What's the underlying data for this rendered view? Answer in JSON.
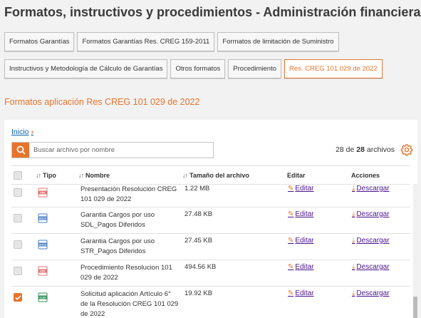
{
  "page": {
    "title": "Formatos, instructivos y procedimientos - Administración financiera"
  },
  "tabs_row1": [
    {
      "label": "Formatos Garantías"
    },
    {
      "label": "Formatos Garantías Res. CREG 159-2011"
    },
    {
      "label": "Formatos de limitación de Suministro"
    }
  ],
  "tabs_row2": [
    {
      "label": "Instructivos y Metodología de Cálculo de Garantías"
    },
    {
      "label": "Otros formatos"
    },
    {
      "label": "Procedimiento"
    },
    {
      "label": "Res. CREG 101 029 de 2022",
      "active": true
    }
  ],
  "section": {
    "title": "Formatos aplicación Res CREG 101 029 de 2022"
  },
  "breadcrumb": {
    "label": "Inicio"
  },
  "search": {
    "placeholder": "Buscar archivo por nombre"
  },
  "count": {
    "prefix": "28 de",
    "shown": "28",
    "suffix": "archivos"
  },
  "table": {
    "headers": {
      "type": "Tipo",
      "name": "Nombre",
      "size": "Tamaño del archivo",
      "edit": "Editar",
      "actions": "Acciones"
    },
    "rows": [
      {
        "type": "PDF",
        "name": "Presentación Resolución CREG 101 029 de 2022",
        "size": "1.22 MB",
        "edit": "Editar",
        "action": "Descargar",
        "checked": false
      },
      {
        "type": "DOCX",
        "name": "Garantia Cargos por uso SDL_Pagos Diferidos",
        "size": "27.48 KB",
        "edit": "Editar",
        "action": "Descargar",
        "checked": false
      },
      {
        "type": "DOCX",
        "name": "Garantia Cargos por uso STR_Pagos Diferidos",
        "size": "27.45 KB",
        "edit": "Editar",
        "action": "Descargar",
        "checked": false
      },
      {
        "type": "PDF",
        "name": "Procedimiento Resolucion 101 029 de 2022",
        "size": "494.56 KB",
        "edit": "Editar",
        "action": "Descargar",
        "checked": false
      },
      {
        "type": "XLSX",
        "name": "Solicitud aplicación Artículo 6° de la Resolución CREG 101 029 de 2022",
        "size": "19.92 KB",
        "edit": "Editar",
        "action": "Descargar",
        "checked": true
      }
    ]
  },
  "colors": {
    "accent": "#e8732c",
    "link": "#4a148c",
    "pdf": "#e57373",
    "docx": "#4a7fc1",
    "xlsx": "#2e8b57"
  }
}
